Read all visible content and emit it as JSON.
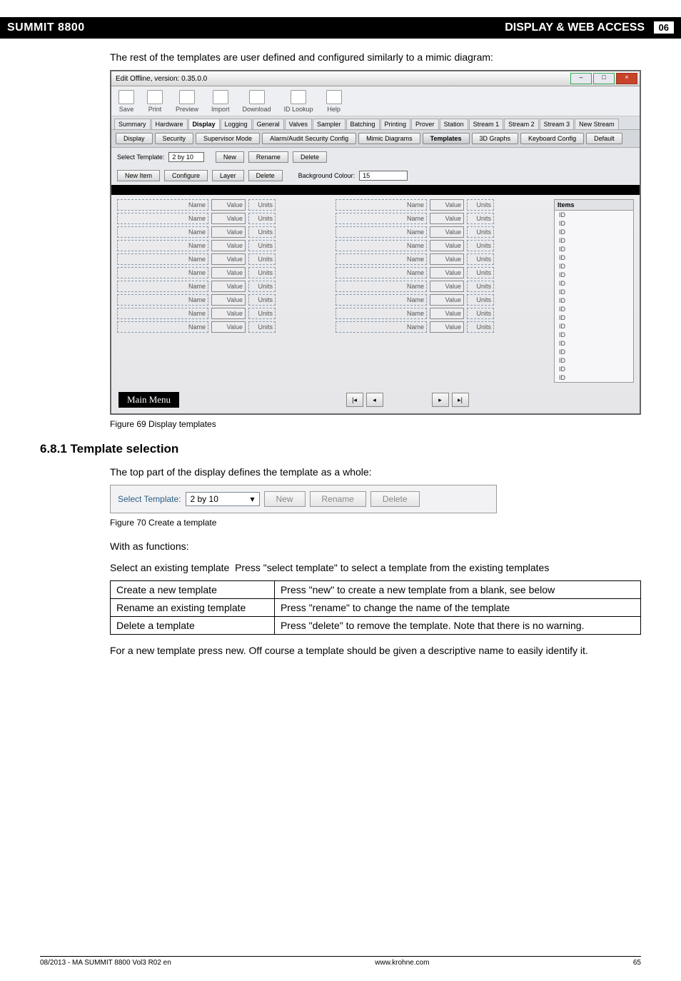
{
  "header": {
    "left": "SUMMIT 8800",
    "right_text": "DISPLAY & WEB ACCESS",
    "pagenum": "06"
  },
  "intro": "The rest of the templates are user defined and configured similarly to a mimic diagram:",
  "app": {
    "title": "Edit Offline, version: 0.35.0.0",
    "toolbar": [
      {
        "label": "Save"
      },
      {
        "label": "Print"
      },
      {
        "label": "Preview"
      },
      {
        "label": "Import"
      },
      {
        "label": "Download"
      },
      {
        "label": "ID Lookup"
      },
      {
        "label": "Help"
      }
    ],
    "tabs_top": [
      "Summary",
      "Hardware",
      "Display",
      "Logging",
      "General",
      "Valves",
      "Sampler",
      "Batching",
      "Printing",
      "Prover",
      "Station",
      "Stream 1",
      "Stream 2",
      "Stream 3",
      "New Stream"
    ],
    "tabs_top_active": "Display",
    "btnrow": [
      "Display",
      "Security",
      "Supervisor Mode",
      "Alarm/Audit Security Config",
      "Mimic Diagrams",
      "Templates",
      "3D Graphs",
      "Keyboard Config",
      "Default"
    ],
    "btnrow_active": "Templates",
    "ctrl1": {
      "label": "Select Template:",
      "value": "2 by 10",
      "new": "New",
      "rename": "Rename",
      "delete": "Delete"
    },
    "ctrl2": {
      "newitem": "New Item",
      "configure": "Configure",
      "layer": "Layer",
      "delete": "Delete",
      "bglabel": "Background Colour:",
      "bgval": "15"
    },
    "grid_labels": {
      "name": "Name",
      "value": "Value",
      "units": "Units"
    },
    "grid_rows": 10,
    "items_header": "Items",
    "items_count": 20,
    "item_label": "ID",
    "navbar": {
      "main": "Main Menu"
    }
  },
  "fig69": "Figure 69    Display templates",
  "section": "6.8.1 Template selection",
  "para1": "The top part of the display defines the template as a whole:",
  "mini": {
    "label": "Select Template:",
    "value": "2 by 10",
    "new": "New",
    "rename": "Rename",
    "delete": "Delete"
  },
  "fig70": "Figure 70    Create a template",
  "withas": "With as functions:",
  "selexisting": "Select an existing template  Press \"select template\" to select a template from the existing templates",
  "table": [
    [
      "Create a new template",
      "Press \"new\" to create a new template from a blank, see below"
    ],
    [
      "Rename an existing template",
      "Press \"rename\" to change the name of the template"
    ],
    [
      "Delete a template",
      "Press \"delete\" to remove the template. Note that there is no warning."
    ]
  ],
  "closing": "For a new template press new. Off course a template should be given a descriptive name to easily identify it.",
  "footer": {
    "left": "08/2013 - MA SUMMIT 8800 Vol3 R02 en",
    "center": "www.krohne.com",
    "right": "65"
  }
}
